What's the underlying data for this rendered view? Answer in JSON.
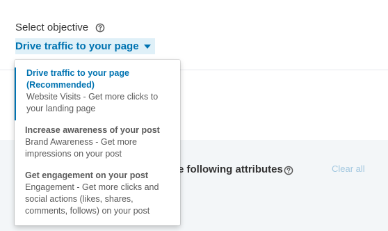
{
  "objective": {
    "label": "Select objective",
    "selected_value": "Drive traffic to your page"
  },
  "dropdown": {
    "options": [
      {
        "title_line1": "Drive traffic to your page",
        "title_line2": "(Recommended)",
        "desc_line1": "Website Visits - Get more clicks to",
        "desc_line2": "your landing page",
        "desc_line3": ""
      },
      {
        "title_line1": "Increase awareness of your post",
        "title_line2": "",
        "desc_line1": "Brand Awareness - Get more",
        "desc_line2": "impressions on your post",
        "desc_line3": ""
      },
      {
        "title_line1": "Get engagement on your post",
        "title_line2": "",
        "desc_line1": "Engagement - Get more clicks and",
        "desc_line2": "social actions (likes, shares,",
        "desc_line3": "comments, follows) on your post"
      }
    ]
  },
  "targeting": {
    "attributes_text": "e following attributes",
    "clear_all": "Clear all"
  },
  "colors": {
    "accent": "#0073b1",
    "selected_bg": "#dff0f8",
    "panel_bg": "#f3f6f8"
  },
  "icons": {
    "help": "question-circle-icon",
    "caret": "caret-down-icon"
  }
}
